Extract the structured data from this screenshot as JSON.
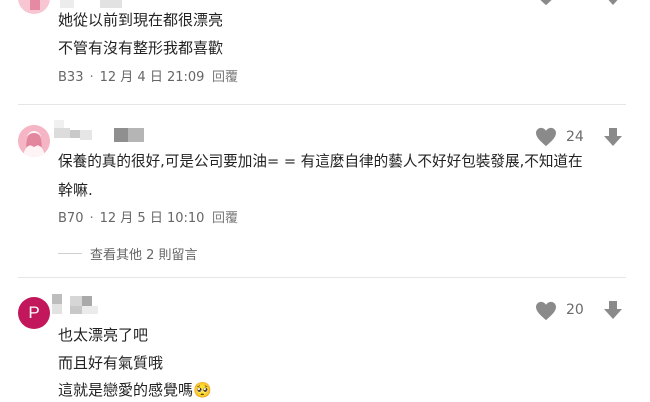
{
  "comments": [
    {
      "lines": [
        "她從以前到現在都很漂亮",
        "不管有沒有整形我都喜歡"
      ],
      "floor": "B33",
      "time": "12 月 4 日 21:09",
      "reply_label": "回覆",
      "likes": ""
    },
    {
      "lines": [
        "保養的真的很好,可是公司要加油= = 有這麼自律的藝人不好好包裝發展,不知道在",
        "幹嘛."
      ],
      "floor": "B70",
      "time": "12 月 5 日 10:10",
      "reply_label": "回覆",
      "likes": "24"
    },
    {
      "avatar_letter": "P",
      "lines": [
        "也太漂亮了吧",
        "而且好有氣質哦",
        "這就是戀愛的感覺嗎🥺"
      ],
      "likes": "20"
    }
  ],
  "view_more_label": "查看其他 2 則留言",
  "colors": {
    "avatar_pink": "#f5b5c4",
    "avatar_magenta": "#c2185b",
    "icon_gray": "#8a8a8a",
    "divider": "#e6e6e6"
  },
  "icons": {
    "like": "heart-icon",
    "dislike": "down-arrow-icon"
  }
}
